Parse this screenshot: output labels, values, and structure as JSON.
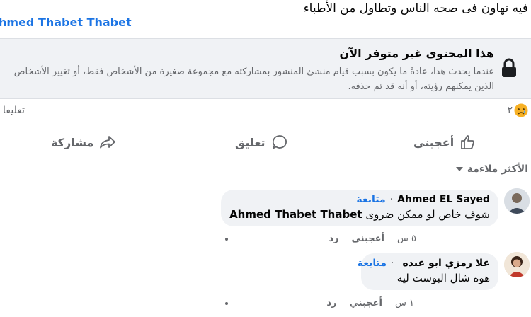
{
  "post": {
    "text": "فيه تهاون فى صحه الناس وتطاول من الأطباء",
    "tagged_name": "hmed Thabet Thabet"
  },
  "unavailable": {
    "title": "هذا المحتوى غير متوفر الآن",
    "body": "عندما يحدث هذا، عادةً ما يكون بسبب قيام منشئ المنشور بمشاركته مع مجموعة صغيرة من الأشخاص فقط، أو تغيير الأشخاص الذين يمكنهم رؤيته، أو أنه قد تم حذفه.",
    "icon": "lock-icon"
  },
  "stats": {
    "reaction_count": "٢",
    "reaction_icon": "sad-emoji-icon",
    "comments_label": "تعليقا"
  },
  "actions": {
    "like": "أعجبني",
    "comment": "تعليق",
    "share": "مشاركة"
  },
  "sort": {
    "label": "الأكثر ملاءمة"
  },
  "comments": [
    {
      "author": "Ahmed EL Sayed",
      "follow": "متابعة",
      "mention": "Ahmed Thabet Thabet",
      "text": "شوف خاص لو ممكن ضروى",
      "time": "٥ س",
      "like": "أعجبني",
      "reply": "رد",
      "verified": false
    },
    {
      "author": "علا رمزي ابو عبده",
      "follow": "متابعة",
      "text": "هوه شال البوست ليه",
      "time": "١ س",
      "like": "أعجبني",
      "reply": "رد",
      "verified": true
    }
  ],
  "colors": {
    "accent": "#1b74e4",
    "muted": "#65676b",
    "bubble": "#f0f2f5"
  }
}
